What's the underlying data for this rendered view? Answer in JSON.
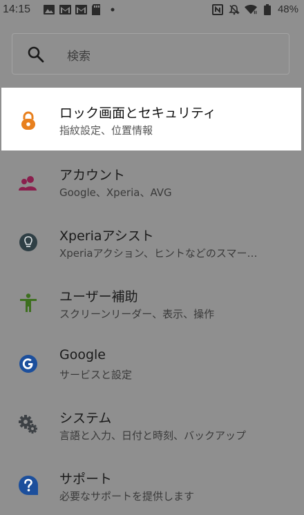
{
  "status_bar": {
    "time": "14:15",
    "battery": "48%",
    "left_icons": [
      "image-icon",
      "gmail-icon",
      "gmail-icon",
      "sd-card-icon",
      "dot-icon"
    ],
    "right_icons": [
      "nfc-icon",
      "mute-icon",
      "wifi-icon",
      "battery-icon"
    ]
  },
  "search": {
    "placeholder": "検索"
  },
  "settings": {
    "items": [
      {
        "title": "ロック画面とセキュリティ",
        "subtitle": "指紋設定、位置情報",
        "icon": "lock-icon",
        "color": "#e8801e",
        "highlighted": true
      },
      {
        "title": "アカウント",
        "subtitle": "Google、Xperia、AVG",
        "icon": "accounts-icon",
        "color": "#8a1f4d"
      },
      {
        "title": "Xperiaアシスト",
        "subtitle": "Xperiaアクション、ヒントなどのスマー…",
        "icon": "lightbulb-icon",
        "color": "#2f3f45"
      },
      {
        "title": "ユーザー補助",
        "subtitle": "スクリーンリーダー、表示、操作",
        "icon": "accessibility-icon",
        "color": "#3d6f1e"
      },
      {
        "title": "Google",
        "subtitle": "サービスと設定",
        "icon": "google-icon",
        "color": "#1c4f9c"
      },
      {
        "title": "システム",
        "subtitle": "言語と入力、日付と時刻、バックアップ",
        "icon": "gears-icon",
        "color": "#3d4145"
      },
      {
        "title": "サポート",
        "subtitle": "必要なサポートを提供します",
        "icon": "help-icon",
        "color": "#1c4f9c"
      }
    ]
  }
}
